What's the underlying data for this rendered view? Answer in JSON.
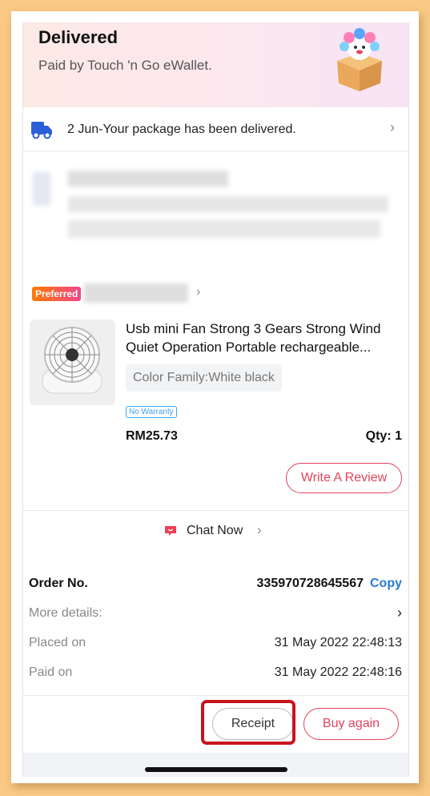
{
  "header": {
    "status": "Delivered",
    "payment": "Paid by Touch 'n Go eWallet."
  },
  "delivery": {
    "text": "2 Jun-Your package has been delivered."
  },
  "store": {
    "badge": "Preferred"
  },
  "product": {
    "title": "Usb mini Fan Strong 3 Gears Strong Wind Quiet Operation Portable rechargeable...",
    "variant": "Color Family:White black",
    "warranty": "No Warranty",
    "price": "RM25.73",
    "qty": "Qty: 1",
    "review_label": "Write A Review",
    "chat_label": "Chat Now"
  },
  "order": {
    "number_label": "Order No.",
    "number": "335970728645567",
    "copy_label": "Copy",
    "more_details_label": "More details:",
    "placed_label": "Placed on",
    "placed_value": "31 May 2022  22:48:13",
    "paid_label": "Paid on",
    "paid_value": "31 May 2022  22:48:16"
  },
  "actions": {
    "receipt_label": "Receipt",
    "buy_again_label": "Buy again"
  },
  "colors": {
    "accent": "#e5435a",
    "link": "#2b7ad6",
    "highlight": "#c8141c",
    "background": "#f9c985"
  }
}
